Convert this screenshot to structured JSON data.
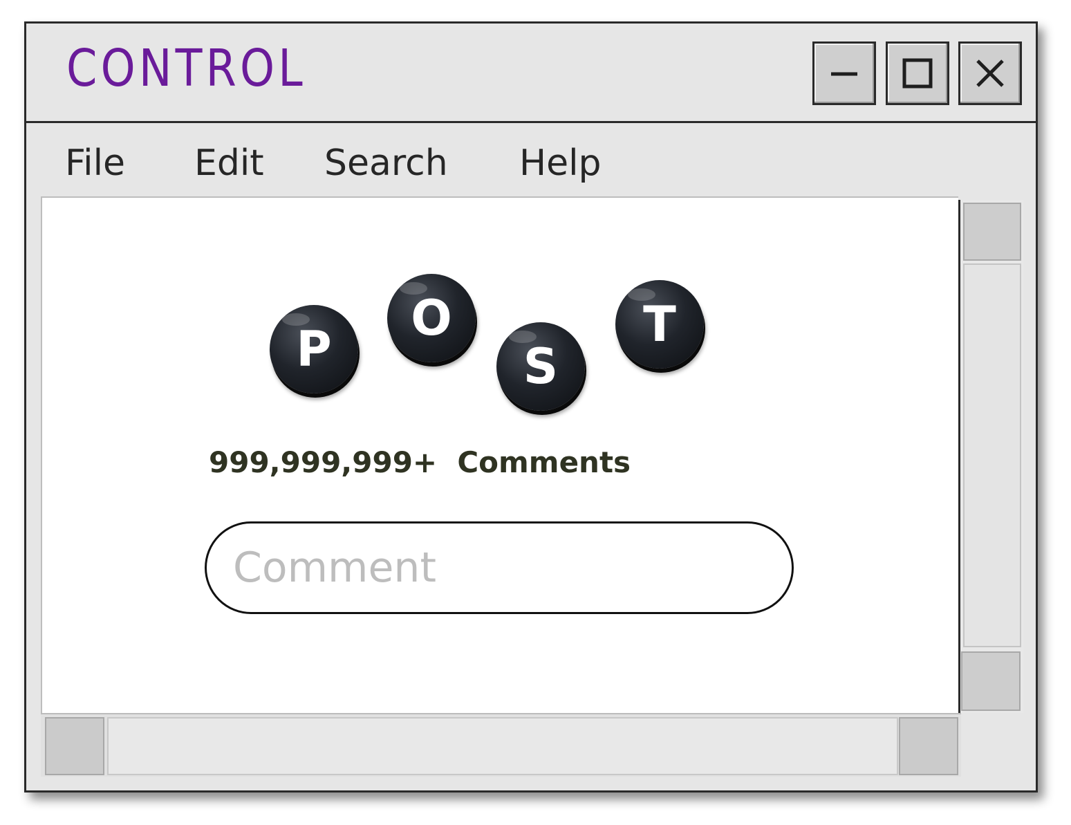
{
  "window": {
    "title": "CONTROL",
    "controls": {
      "minimize_icon": "minimize-icon",
      "maximize_icon": "maximize-icon",
      "close_icon": "close-icon"
    }
  },
  "menu": {
    "items": [
      {
        "label": "File"
      },
      {
        "label": "Edit"
      },
      {
        "label": "Search"
      },
      {
        "label": "Help"
      }
    ]
  },
  "post": {
    "beads": [
      {
        "letter": "P"
      },
      {
        "letter": "O"
      },
      {
        "letter": "S"
      },
      {
        "letter": "T"
      }
    ],
    "comment_count": "999,999,999+  Comments",
    "comment_input": {
      "placeholder": "Comment",
      "value": ""
    }
  },
  "colors": {
    "title": "#6a1b9a",
    "window_bg": "#e6e6e6",
    "content_bg": "#ffffff",
    "bead": "#1b1e24"
  }
}
